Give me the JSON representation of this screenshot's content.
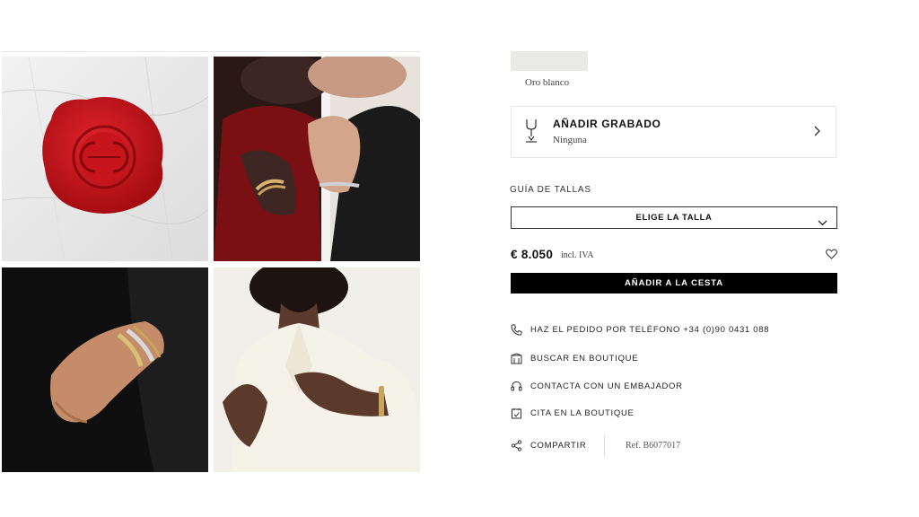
{
  "product": {
    "material": "Oro blanco",
    "engraving": {
      "title": "AÑADIR GRABADO",
      "value": "Ninguna"
    },
    "size_guide_label": "GUÍA DE TALLAS",
    "size_select_label": "ELIGE LA TALLA",
    "price": "€ 8.050",
    "vat_note": "incl. IVA",
    "add_to_cart": "AÑADIR A LA CESTA",
    "reference": "Ref. B6077017"
  },
  "actions": [
    {
      "label": "HAZ EL PEDIDO POR TELÉFONO +34 (0)90 0431 088",
      "icon": "phone-icon"
    },
    {
      "label": "BUSCAR EN BOUTIQUE",
      "icon": "boutique-icon"
    },
    {
      "label": "CONTACTA CON UN EMBAJADOR",
      "icon": "headset-icon"
    },
    {
      "label": "CITA EN LA BOUTIQUE",
      "icon": "calendar-icon"
    },
    {
      "label": "COMPARTIR",
      "icon": "share-icon"
    }
  ],
  "gallery": [
    "wax-seal",
    "couple-bracelets",
    "hand-bracelets",
    "woman-cuff"
  ],
  "colors": {
    "seal_red": "#c8141b",
    "text": "#111111",
    "button": "#000000",
    "gold": "#c9a45c"
  }
}
